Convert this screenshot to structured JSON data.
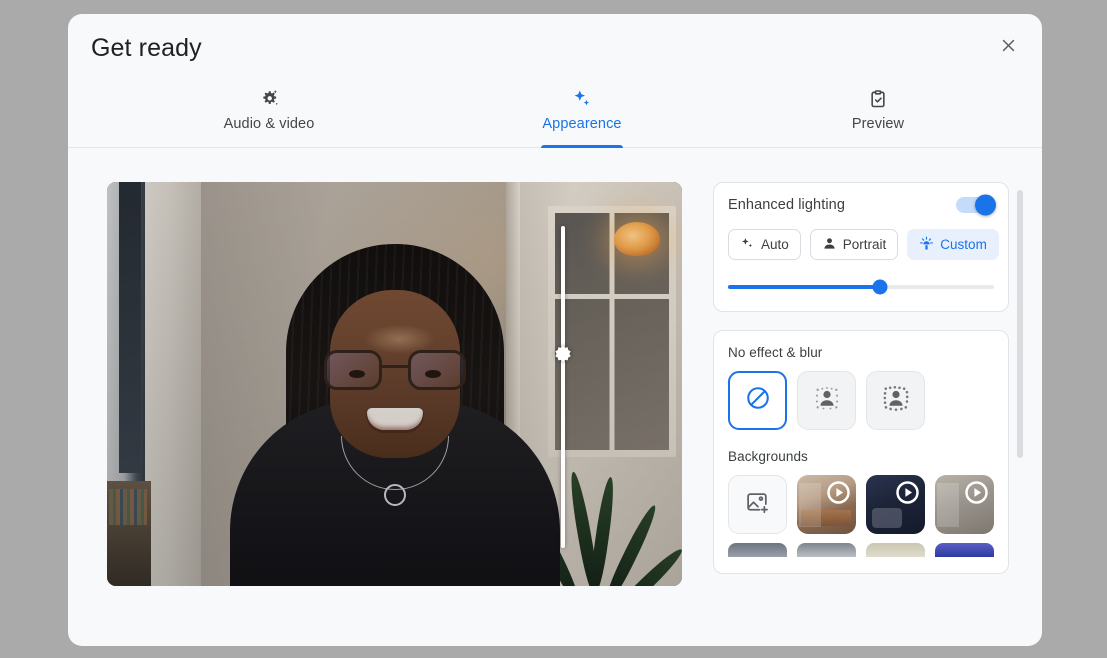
{
  "dialog": {
    "title": "Get ready",
    "close_label": "Close",
    "close_icon": "close-icon"
  },
  "tabs": [
    {
      "id": "audio-video",
      "label": "Audio & video",
      "icon": "gear-sparkle-icon",
      "active": false
    },
    {
      "id": "appearance",
      "label": "Appearence",
      "icon": "sparkles-icon",
      "active": true
    },
    {
      "id": "preview",
      "label": "Preview",
      "icon": "clipboard-check-icon",
      "active": false
    }
  ],
  "video_preview": {
    "name": "self-video-preview",
    "brightness_slider": {
      "name": "brightness-vertical-slider",
      "value": 40,
      "min": 0,
      "max": 100,
      "handle_icon": "brightness-icon"
    }
  },
  "enhanced_lighting": {
    "title": "Enhanced lighting",
    "toggle": {
      "name": "enhanced-lighting-toggle",
      "state": "on"
    },
    "modes": [
      {
        "id": "auto",
        "label": "Auto",
        "icon": "sparkles-icon",
        "selected": false
      },
      {
        "id": "portrait",
        "label": "Portrait",
        "icon": "person-icon",
        "selected": false
      },
      {
        "id": "custom",
        "label": "Custom",
        "icon": "lamp-icon",
        "selected": true
      }
    ],
    "intensity_slider": {
      "name": "lighting-intensity-slider",
      "value": 57,
      "min": 0,
      "max": 100
    }
  },
  "effects": {
    "title": "No effect & blur",
    "items": [
      {
        "id": "no-effect",
        "icon": "no-effect-icon",
        "selected": true
      },
      {
        "id": "slight-blur",
        "icon": "slight-blur-icon",
        "selected": false
      },
      {
        "id": "blur",
        "icon": "blur-icon",
        "selected": false
      }
    ]
  },
  "backgrounds": {
    "title": "Backgrounds",
    "items": [
      {
        "id": "upload",
        "type": "add",
        "icon": "add-image-icon"
      },
      {
        "id": "bg-warm-room",
        "type": "video",
        "icon": "play-icon",
        "theme": "warm"
      },
      {
        "id": "bg-night-room",
        "type": "video",
        "icon": "play-icon",
        "theme": "night"
      },
      {
        "id": "bg-gray-window",
        "type": "video",
        "icon": "play-icon",
        "theme": "gray"
      }
    ],
    "row2": [
      {
        "id": "bg-row2-1",
        "theme": "cut-1"
      },
      {
        "id": "bg-row2-2",
        "theme": "cut-2"
      },
      {
        "id": "bg-row2-3",
        "theme": "cut-3"
      },
      {
        "id": "bg-row2-4",
        "theme": "cut-4"
      }
    ]
  },
  "colors": {
    "accent": "#1a73e8",
    "accent_soft": "#e8f0fe",
    "dialog_bg": "#f8f9fa",
    "page_bg": "#aaaaaa",
    "text": "#3c4043"
  }
}
